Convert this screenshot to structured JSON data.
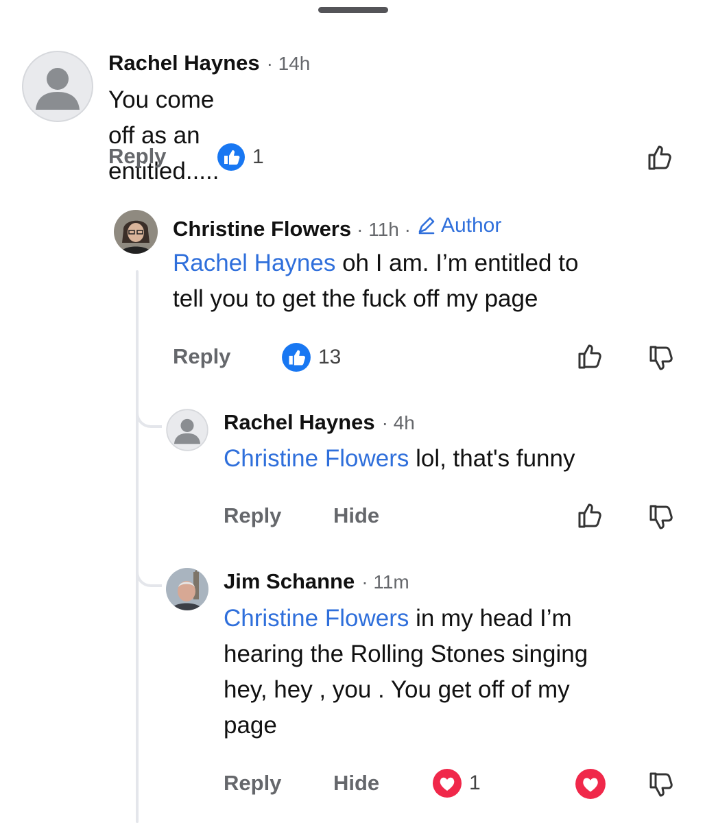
{
  "comments": [
    {
      "name": "Rachel Haynes",
      "time": "· 14h",
      "mention": "",
      "text": "You come off as an entitled.....",
      "actions": {
        "reply": "Reply",
        "reaction_count": "1"
      },
      "reaction": "like-icon",
      "vote_icons": [
        "thumbs-up-outline-icon"
      ]
    },
    {
      "name": "Christine Flowers",
      "time": "· 11h ·",
      "badge": "Author",
      "mention": "Rachel Haynes",
      "text_lines": [
        "oh I am. I’m entitled to",
        "tell you to get the fuck off my page"
      ],
      "actions": {
        "reply": "Reply",
        "reaction_count": "13"
      },
      "reaction": "like-icon",
      "vote_icons": [
        "thumbs-up-outline-icon",
        "thumbs-down-outline-icon"
      ]
    },
    {
      "name": "Rachel Haynes",
      "time": "· 4h",
      "mention": "Christine Flowers",
      "text": "lol, that's funny",
      "actions": {
        "reply": "Reply",
        "hide": "Hide"
      },
      "vote_icons": [
        "thumbs-up-outline-icon",
        "thumbs-down-outline-icon"
      ]
    },
    {
      "name": "Jim Schanne",
      "time": "· 11m",
      "mention": "Christine Flowers",
      "text_lines": [
        "in my head I’m",
        "hearing the Rolling Stones singing",
        "hey, hey , you . You get off of my",
        "page"
      ],
      "actions": {
        "reply": "Reply",
        "hide": "Hide",
        "reaction_count": "1"
      },
      "reaction": "love-icon",
      "vote_icons": [
        "love-filled-icon",
        "thumbs-down-outline-icon"
      ]
    }
  ],
  "colors": {
    "link": "#2f6fdb",
    "like_blue": "#1877f2",
    "love_red": "#f0284a",
    "muted": "#65676b"
  }
}
